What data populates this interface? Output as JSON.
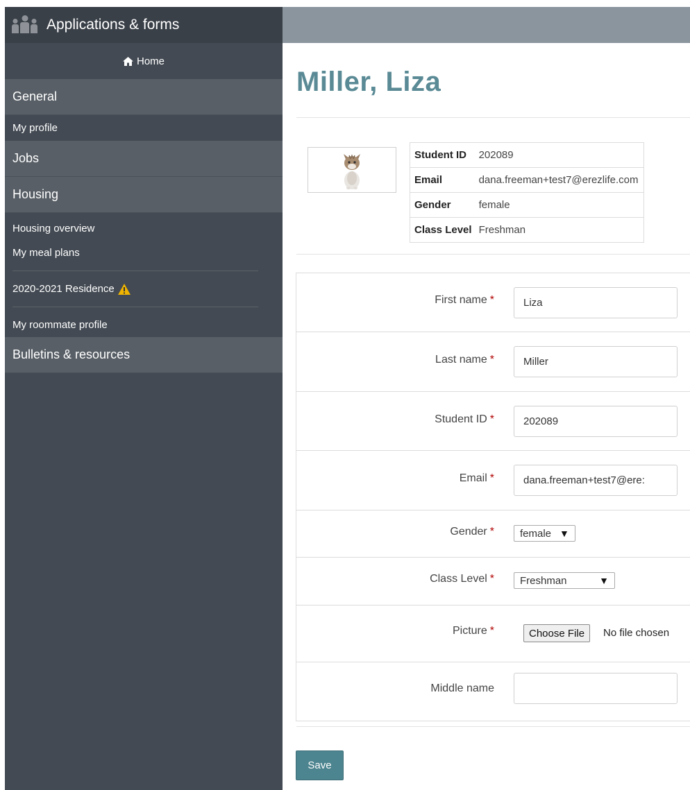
{
  "sidebar": {
    "title": "Applications & forms",
    "home": "Home",
    "sections": {
      "general": "General",
      "jobs": "Jobs",
      "housing": "Housing",
      "bulletins": "Bulletins & resources"
    },
    "items": {
      "my_profile": "My profile",
      "housing_overview": "Housing overview",
      "my_meal_plans": "My meal plans",
      "residence": "2020-2021 Residence",
      "roommate_profile": "My roommate profile"
    }
  },
  "page": {
    "title": "Miller, Liza"
  },
  "profile": {
    "student_id_label": "Student ID",
    "student_id": "202089",
    "email_label": "Email",
    "email": "dana.freeman+test7@erezlife.com",
    "gender_label": "Gender",
    "gender": "female",
    "class_level_label": "Class Level",
    "class_level": "Freshman"
  },
  "form": {
    "first_name_label": "First name",
    "first_name": "Liza",
    "last_name_label": "Last name",
    "last_name": "Miller",
    "student_id_label": "Student ID",
    "student_id": "202089",
    "email_label": "Email",
    "email": "dana.freeman+test7@ere:",
    "gender_label": "Gender",
    "gender": "female",
    "class_level_label": "Class Level",
    "class_level": "Freshman",
    "picture_label": "Picture",
    "choose_file": "Choose File",
    "no_file": "No file chosen",
    "middle_name_label": "Middle name",
    "middle_name": "",
    "required_mark": "*"
  },
  "actions": {
    "save": "Save"
  },
  "colors": {
    "sidebar_bg": "#434a53",
    "section_bg": "#585f66",
    "topbar_bg": "#8b959e",
    "title_color": "#5a8a95",
    "save_bg": "#4c848f",
    "required_color": "#b00000",
    "warning": "#f0b400"
  }
}
